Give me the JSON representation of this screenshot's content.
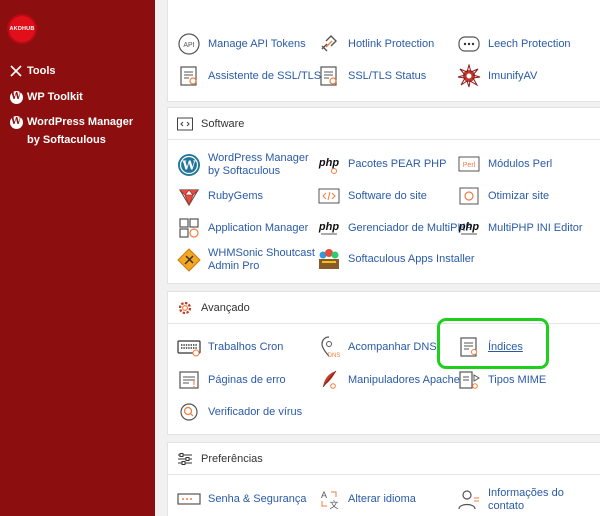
{
  "sidebar": {
    "logo_text": "AKDHUB",
    "items": [
      {
        "label": "Tools",
        "icon": "tools-icon"
      },
      {
        "label": "WP Toolkit",
        "icon": "wordpress-icon"
      },
      {
        "label": "WordPress Manager by Softaculous",
        "icon": "wordpress-icon"
      }
    ]
  },
  "security": {
    "items": [
      {
        "label": "Manage API Tokens",
        "icon": "api-icon"
      },
      {
        "label": "Hotlink Protection",
        "icon": "link-icon"
      },
      {
        "label": "Leech Protection",
        "icon": "dots-icon"
      },
      {
        "label": "Assistente de SSL/TLS",
        "icon": "certificate-icon"
      },
      {
        "label": "SSL/TLS Status",
        "icon": "certificate-icon"
      },
      {
        "label": "ImunifyAV",
        "icon": "imunify-icon"
      }
    ]
  },
  "software": {
    "title": "Software",
    "items": [
      {
        "label": "WordPress Manager by Softaculous",
        "icon": "wordpress-icon"
      },
      {
        "label": "Pacotes PEAR PHP",
        "icon": "php-icon"
      },
      {
        "label": "Módulos Perl",
        "icon": "perl-icon"
      },
      {
        "label": "RubyGems",
        "icon": "ruby-icon"
      },
      {
        "label": "Software do site",
        "icon": "code-icon"
      },
      {
        "label": "Otimizar site",
        "icon": "gauge-icon"
      },
      {
        "label": "Application Manager",
        "icon": "grid-icon"
      },
      {
        "label": "Gerenciador de MultiPHP",
        "icon": "php-icon"
      },
      {
        "label": "MultiPHP INI Editor",
        "icon": "php-icon"
      },
      {
        "label": "WHMSonic Shoutcast Admin Pro",
        "icon": "whmsonic-icon"
      },
      {
        "label": "Softaculous Apps Installer",
        "icon": "softaculous-icon"
      }
    ]
  },
  "avancado": {
    "title": "Avançado",
    "items": [
      {
        "label": "Trabalhos Cron",
        "icon": "keyboard-icon"
      },
      {
        "label": "Acompanhar DNS",
        "icon": "dns-icon"
      },
      {
        "label": "Índices",
        "icon": "index-icon"
      },
      {
        "label": "Páginas de erro",
        "icon": "error-page-icon"
      },
      {
        "label": "Manipuladores Apache",
        "icon": "feather-icon"
      },
      {
        "label": "Tipos MIME",
        "icon": "mime-icon"
      },
      {
        "label": "Verificador de vírus",
        "icon": "virus-icon"
      }
    ]
  },
  "preferencias": {
    "title": "Preferências",
    "items": [
      {
        "label": "Senha & Segurança",
        "icon": "password-icon"
      },
      {
        "label": "Alterar idioma",
        "icon": "language-icon"
      },
      {
        "label": "Informações do contato",
        "icon": "contact-icon"
      }
    ]
  },
  "colors": {
    "sidebar": "#8c0e0e",
    "link": "#2a5aa7",
    "accent": "#f47c3c",
    "highlight": "#1ecf1e"
  }
}
